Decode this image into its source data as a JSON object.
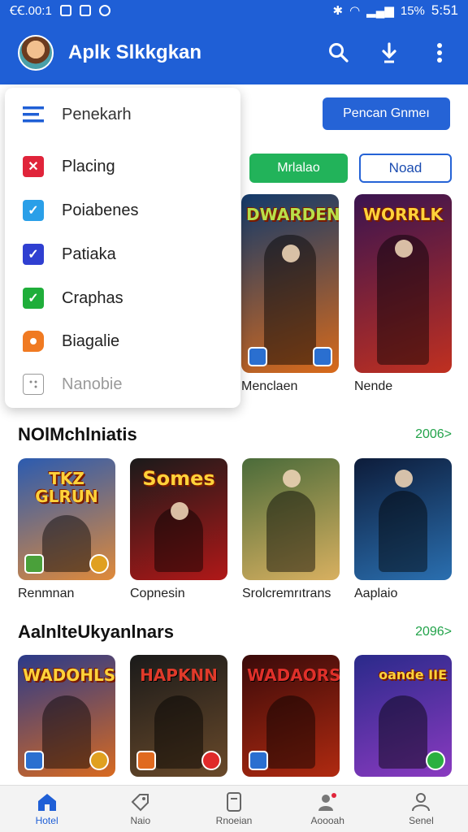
{
  "status_bar": {
    "left_text": "ꞒꞒ.00:1",
    "battery": "15%",
    "time": "5:51"
  },
  "app_bar": {
    "title": "Aplk Slkkgkan"
  },
  "header": {
    "primary_button": "Pencan Gnmeı"
  },
  "filters": {
    "green_chip": "Mrlalao",
    "outline_chip": "Noad"
  },
  "menu": {
    "header_label": "Penekarh",
    "items": [
      {
        "label": "Placing",
        "color": "#e0243a",
        "mark": "✕"
      },
      {
        "label": "Poiabenes",
        "color": "#2a9fe8",
        "mark": "✓"
      },
      {
        "label": "Patiaka",
        "color": "#2f3fd1",
        "mark": "✓"
      },
      {
        "label": "Craphas",
        "color": "#1fae3a",
        "mark": "✓"
      },
      {
        "label": "Biagalie",
        "color": "#f07a22",
        "mark": ""
      },
      {
        "label": "Nanobie",
        "color": "#9a9a9a",
        "mark": ""
      }
    ]
  },
  "top_row": {
    "cards": [
      {
        "title": "DWARDEN",
        "label": "Menclaen",
        "colors": [
          "#123a6b",
          "#d96a1a"
        ]
      },
      {
        "title": "WORRLK",
        "label": "Nende",
        "colors": [
          "#3a1450",
          "#c03020"
        ]
      }
    ]
  },
  "sections": [
    {
      "title": "NOlMchlniatis",
      "see_more": "2006>",
      "cards": [
        {
          "title": "TKZ GLRUN",
          "label": "Renmnan",
          "colors": [
            "#2b5bb0",
            "#e08a3a"
          ]
        },
        {
          "title": "Somes",
          "label": "Copnesin",
          "colors": [
            "#1a1a1a",
            "#b01818"
          ]
        },
        {
          "title": "",
          "label": "Srolcremrıtrans",
          "colors": [
            "#4a6b3a",
            "#d8b060"
          ]
        },
        {
          "title": "",
          "label": "Aaplaio",
          "colors": [
            "#0d1c3a",
            "#2a6fb0"
          ]
        }
      ]
    },
    {
      "title": "AalnlteUkyanlnars",
      "see_more": "2096>",
      "cards": [
        {
          "title": "WADOHLS",
          "label": "",
          "colors": [
            "#2a3a8a",
            "#d86a20"
          ]
        },
        {
          "title": "HAPKNN",
          "label": "",
          "colors": [
            "#1a1a1a",
            "#6a4a2a"
          ]
        },
        {
          "title": "WADAORS",
          "label": "",
          "colors": [
            "#3a0a0a",
            "#b02a10"
          ]
        },
        {
          "title": "oande IIE",
          "label": "",
          "colors": [
            "#2a2a8a",
            "#8a3ac0"
          ]
        }
      ]
    }
  ],
  "bottom_nav": [
    {
      "label": "Hotel",
      "icon": "home-icon"
    },
    {
      "label": "Naio",
      "icon": "tag-icon"
    },
    {
      "label": "Rnoeian",
      "icon": "document-icon"
    },
    {
      "label": "Aoooah",
      "icon": "people-icon"
    },
    {
      "label": "Senel",
      "icon": "person-icon"
    }
  ]
}
